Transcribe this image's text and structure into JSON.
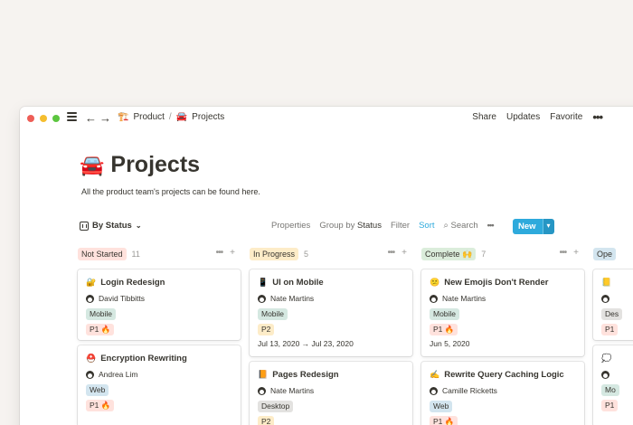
{
  "header": {
    "breadcrumbs": [
      {
        "icon": "🏗️",
        "label": "Product"
      },
      {
        "icon": "🚘",
        "label": "Projects"
      }
    ],
    "separator": "/",
    "actions": [
      "Share",
      "Updates",
      "Favorite"
    ],
    "more": "•••"
  },
  "page": {
    "emoji": "🚘",
    "title": "Projects",
    "description": "All the product team's projects can be found here."
  },
  "toolbar": {
    "view": "By Status",
    "properties": "Properties",
    "group_by": "Group by",
    "group_by_value": "Status",
    "filter": "Filter",
    "sort": "Sort",
    "search": "Search",
    "more": "•••",
    "new": "New",
    "accent": "#2eaadc"
  },
  "columns": [
    {
      "label": "Not Started",
      "count": "11",
      "color": "#ffe2dd",
      "cards": [
        {
          "emoji": "🔐",
          "title": "Login Redesign",
          "person": "David Tibbitts",
          "platform": "Mobile",
          "priority": "P1 🔥",
          "date": ""
        },
        {
          "emoji": "⛑️",
          "title": "Encryption Rewriting",
          "person": "Andrea Lim",
          "platform": "Web",
          "priority": "P1 🔥",
          "date": ""
        }
      ]
    },
    {
      "label": "In Progress",
      "count": "5",
      "color": "#fdecc8",
      "cards": [
        {
          "emoji": "📱",
          "title": "UI on Mobile",
          "person": "Nate Martins",
          "platform": "Mobile",
          "priority": "P2",
          "date": "Jul 13, 2020 → Jul 23, 2020"
        },
        {
          "emoji": "📙",
          "title": "Pages Redesign",
          "person": "Nate Martins",
          "platform": "Desktop",
          "priority": "P2",
          "date": ""
        }
      ]
    },
    {
      "label": "Complete 🙌",
      "count": "7",
      "color": "#dbeddb",
      "cards": [
        {
          "emoji": "😕",
          "title": "New Emojis Don't Render",
          "person": "Nate Martins",
          "platform": "Mobile",
          "priority": "P1 🔥",
          "date": "Jun 5, 2020"
        },
        {
          "emoji": "✍️",
          "title": "Rewrite Query Caching Logic",
          "person": "Camille Ricketts",
          "platform": "Web",
          "priority": "P1 🔥",
          "date": ""
        }
      ]
    },
    {
      "label": "Ope",
      "count": "",
      "color": "#d3e5ef",
      "cards": [
        {
          "emoji": "📒",
          "title": "",
          "person": "",
          "platform": "Des",
          "priority": "P1",
          "date": ""
        },
        {
          "emoji": "💭",
          "title": "",
          "person": "",
          "platform": "Mo",
          "priority": "P1",
          "date": ""
        }
      ]
    }
  ]
}
